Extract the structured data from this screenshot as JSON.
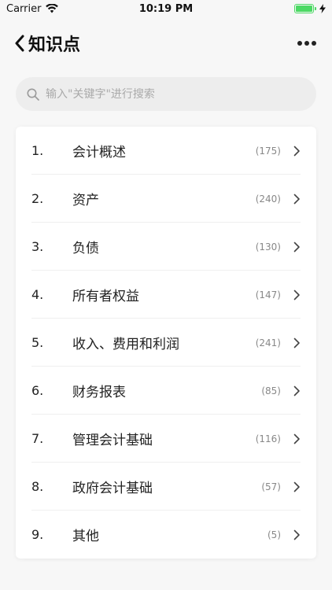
{
  "status_bar": {
    "carrier": "Carrier",
    "time": "10:19 PM",
    "battery_level": 1.0
  },
  "nav": {
    "title": "知识点",
    "back_icon": "chevron-left-icon",
    "more_icon": "more-horizontal-icon"
  },
  "search": {
    "value": "",
    "placeholder": "输入\"关键字\"进行搜索",
    "icon": "search-icon"
  },
  "items": [
    {
      "num": "1.",
      "label": "会计概述",
      "count": "(175)"
    },
    {
      "num": "2.",
      "label": "资产",
      "count": "(240)"
    },
    {
      "num": "3.",
      "label": "负债",
      "count": "(130)"
    },
    {
      "num": "4.",
      "label": "所有者权益",
      "count": "(147)"
    },
    {
      "num": "5.",
      "label": "收入、费用和利润",
      "count": "(241)"
    },
    {
      "num": "6.",
      "label": "财务报表",
      "count": "(85)"
    },
    {
      "num": "7.",
      "label": "管理会计基础",
      "count": "(116)"
    },
    {
      "num": "8.",
      "label": "政府会计基础",
      "count": "(57)"
    },
    {
      "num": "9.",
      "label": "其他",
      "count": "(5)"
    }
  ],
  "colors": {
    "background": "#f7f7f7",
    "card": "#ffffff",
    "search_bg": "#ededed",
    "battery": "#4cd964"
  }
}
